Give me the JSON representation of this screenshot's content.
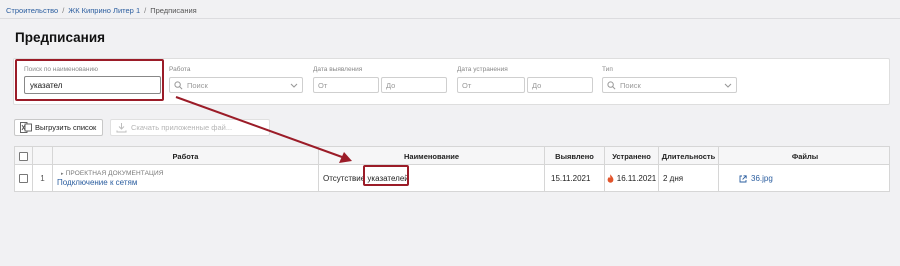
{
  "breadcrumb": {
    "items": [
      "Строительство",
      "ЖК Киприно Литер 1",
      "Предписания"
    ],
    "separator": "/"
  },
  "page": {
    "title": "Предписания"
  },
  "filters": {
    "search": {
      "label": "Поиск по наименованию",
      "value": "указател"
    },
    "work": {
      "label": "Работа",
      "placeholder": "Поиск"
    },
    "detected_date": {
      "label": "Дата выявления",
      "from_placeholder": "От",
      "to_placeholder": "До"
    },
    "fixed_date": {
      "label": "Дата устранения",
      "from_placeholder": "От",
      "to_placeholder": "До"
    },
    "type": {
      "label": "Тип",
      "placeholder": "Поиск"
    }
  },
  "toolbar": {
    "export_label": "Выгрузить список",
    "download_label": "Скачать приложенные фай..."
  },
  "table": {
    "columns": [
      "Работа",
      "Наименование",
      "Выявлено",
      "Устранено",
      "Длительность",
      "Файлы"
    ],
    "rows": [
      {
        "index": "1",
        "category": "ПРОЕКТНАЯ ДОКУМЕНТАЦИЯ",
        "work": "Подключение к сетям",
        "name": "Отсутствие указателей",
        "detected": "15.11.2021",
        "fixed": "16.11.2021",
        "duration": "2 дня",
        "file": "36.jpg"
      }
    ]
  },
  "colors": {
    "accent": "#2a5d9f",
    "highlight": "#9b1c28",
    "fire": "#e2542b"
  }
}
